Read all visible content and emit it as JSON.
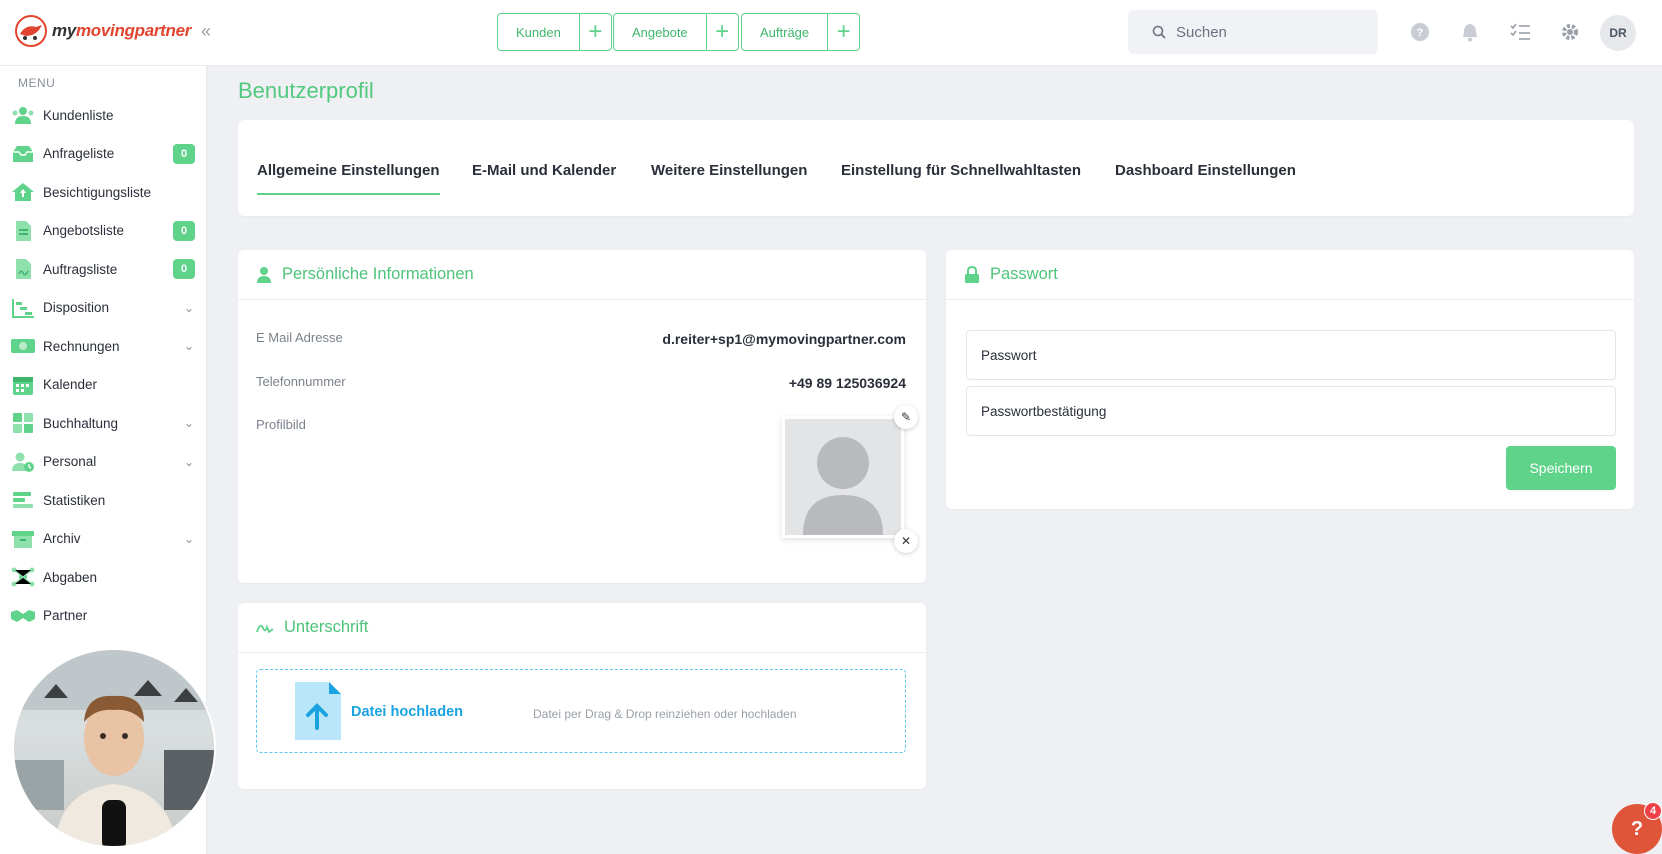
{
  "brand": {
    "logo_my": "my",
    "logo_rest": "movingpartner",
    "accent": "#5fd38a",
    "logo_color": "#e2452f"
  },
  "quick_actions": [
    {
      "label": "Kunden"
    },
    {
      "label": "Angebote"
    },
    {
      "label": "Aufträge"
    }
  ],
  "search": {
    "placeholder": "Suchen"
  },
  "user": {
    "initials": "DR"
  },
  "sidebar": {
    "heading": "MENU",
    "items": [
      {
        "label": "Kundenliste",
        "icon": "users-icon"
      },
      {
        "label": "Anfrageliste",
        "icon": "inbox-icon",
        "badge": "0"
      },
      {
        "label": "Besichtigungsliste",
        "icon": "home-icon"
      },
      {
        "label": "Angebotsliste",
        "icon": "document-icon",
        "badge": "0"
      },
      {
        "label": "Auftragsliste",
        "icon": "contract-icon",
        "badge": "0"
      },
      {
        "label": "Disposition",
        "icon": "gantt-icon",
        "expandable": true
      },
      {
        "label": "Rechnungen",
        "icon": "money-icon",
        "expandable": true
      },
      {
        "label": "Kalender",
        "icon": "calendar-icon"
      },
      {
        "label": "Buchhaltung",
        "icon": "calculator-icon",
        "expandable": true
      },
      {
        "label": "Personal",
        "icon": "staff-icon",
        "expandable": true
      },
      {
        "label": "Statistiken",
        "icon": "stats-icon"
      },
      {
        "label": "Archiv",
        "icon": "archive-icon",
        "expandable": true
      },
      {
        "label": "Abgaben",
        "icon": "network-icon"
      },
      {
        "label": "Partner",
        "icon": "handshake-icon"
      }
    ]
  },
  "page": {
    "title": "Benutzerprofil"
  },
  "tabs": [
    {
      "label": "Allgemeine Einstellungen",
      "active": true
    },
    {
      "label": "E-Mail und Kalender"
    },
    {
      "label": "Weitere Einstellungen"
    },
    {
      "label": "Einstellung für Schnellwahltasten"
    },
    {
      "label": "Dashboard Einstellungen"
    }
  ],
  "personal": {
    "title": "Persönliche Informationen",
    "email_label": "E Mail Adresse",
    "email_value": "d.reiter+sp1@mymovingpartner.com",
    "phone_label": "Telefonnummer",
    "phone_value": "+49 89 125036924",
    "picture_label": "Profilbild"
  },
  "password": {
    "title": "Passwort",
    "password_placeholder": "Passwort",
    "confirm_placeholder": "Passwortbestätigung",
    "save_label": "Speichern"
  },
  "signature": {
    "title": "Unterschrift",
    "upload_title": "Datei hochladen",
    "upload_hint": "Datei per Drag & Drop reinziehen oder hochladen"
  },
  "help": {
    "label": "?",
    "badge": "4"
  }
}
